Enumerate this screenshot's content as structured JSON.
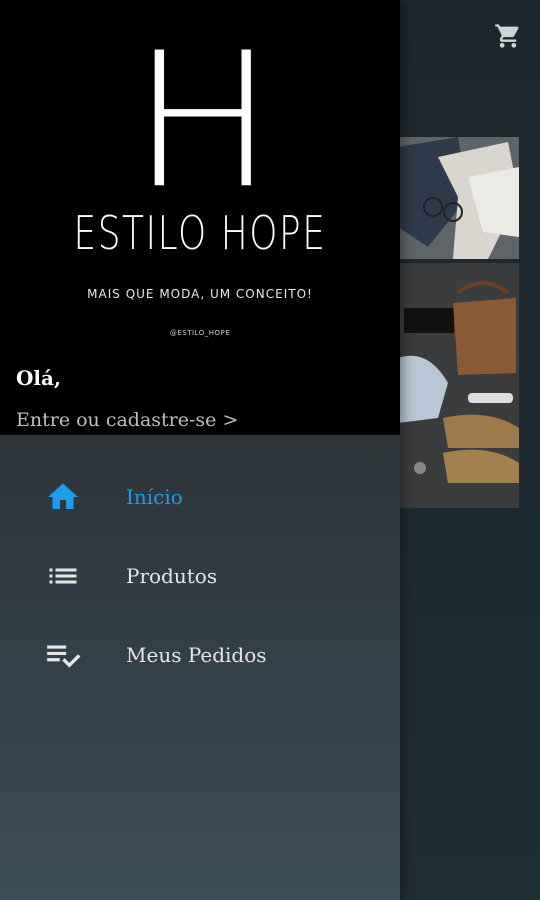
{
  "drawer": {
    "brand": {
      "letter": "H",
      "name": "ESTILO HOPE",
      "tagline": "MAIS QUE MODA, UM CONCEITO!",
      "handle": "@ESTILO_HOPE"
    },
    "greeting": "Olá,",
    "login_link": "Entre ou cadastre-se >",
    "menu": [
      {
        "label": "Início",
        "icon": "home-icon",
        "active": true
      },
      {
        "label": "Produtos",
        "icon": "list-icon",
        "active": false
      },
      {
        "label": "Meus Pedidos",
        "icon": "playlist-check-icon",
        "active": false
      }
    ]
  },
  "toolbar": {
    "cart_icon": "cart-icon"
  },
  "colors": {
    "accent": "#1e9be9",
    "header_bg": "#000000",
    "text": "#e6e6e6"
  }
}
